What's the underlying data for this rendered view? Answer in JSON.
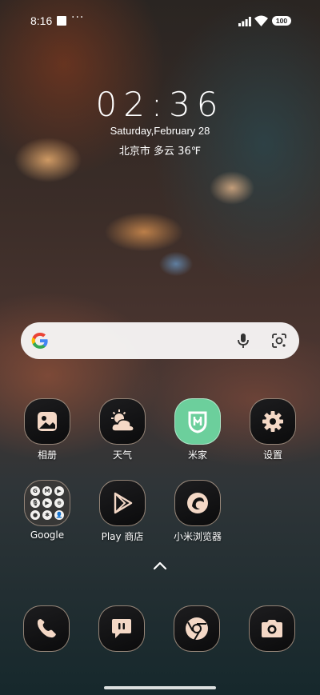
{
  "status_bar": {
    "time": "8:16",
    "more": "···",
    "battery": "100"
  },
  "clock_widget": {
    "time": "02:36",
    "date": "Saturday,February 28",
    "weather": "北京市 多云 36℉"
  },
  "search_bar": {
    "icons": [
      "google-g-icon",
      "mic-icon",
      "google-lens-icon"
    ]
  },
  "apps": {
    "row1": [
      {
        "label": "相册",
        "icon": "gallery-icon"
      },
      {
        "label": "天气",
        "icon": "weather-icon"
      },
      {
        "label": "米家",
        "icon": "mijia-icon"
      },
      {
        "label": "设置",
        "icon": "gear-icon"
      }
    ],
    "row2": [
      {
        "label": "Google",
        "icon": "folder-icon",
        "folder_items": [
          "G",
          "M",
          "▶",
          "🎙",
          "▶",
          "⊕",
          "●",
          "✱",
          "👤"
        ]
      },
      {
        "label": "Play 商店",
        "icon": "play-store-icon"
      },
      {
        "label": "小米浏览器",
        "icon": "browser-icon"
      }
    ]
  },
  "dock": [
    {
      "name": "phone",
      "icon": "phone-icon"
    },
    {
      "name": "messages",
      "icon": "message-icon"
    },
    {
      "name": "chrome",
      "icon": "chrome-icon"
    },
    {
      "name": "camera",
      "icon": "camera-icon"
    }
  ],
  "colors": {
    "icon_bg": "#111111",
    "icon_accent": "#f4d8c6",
    "mijia_green": "#6ccf9c"
  }
}
